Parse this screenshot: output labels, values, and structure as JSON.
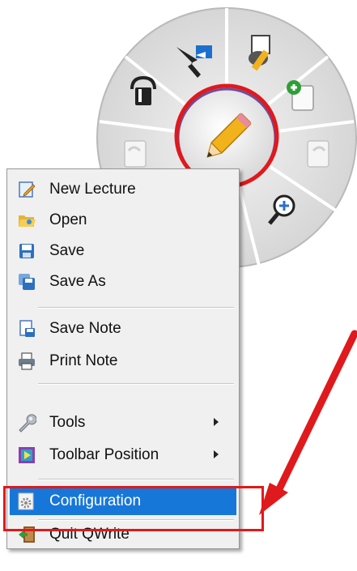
{
  "menu": {
    "items": [
      {
        "label": "New Lecture",
        "icon": "new-lecture-icon"
      },
      {
        "label": "Open",
        "icon": "open-folder-icon"
      },
      {
        "label": "Save",
        "icon": "save-disk-icon"
      },
      {
        "label": "Save As",
        "icon": "save-as-icon"
      },
      {
        "label": "Save Note",
        "icon": "save-note-icon"
      },
      {
        "label": "Print Note",
        "icon": "printer-icon"
      },
      {
        "label": "Tools",
        "icon": "wrench-icon",
        "submenu": true
      },
      {
        "label": "Toolbar Position",
        "icon": "toolbar-position-icon",
        "submenu": true
      },
      {
        "label": "Configuration",
        "icon": "gear-icon",
        "highlighted": true
      },
      {
        "label": "Quit QWrite",
        "icon": "exit-door-icon"
      }
    ]
  },
  "wheel": {
    "segments": [
      "pointer-arrow-icon",
      "eraser-pen-icon",
      "new-page-icon",
      "next-page-icon",
      "zoom-in-icon",
      "previous-page-icon",
      "paint-bucket-icon"
    ],
    "center": "pencil-icon"
  },
  "colors": {
    "annotation_red": "#e0191c",
    "highlight_blue": "#1777d9",
    "menu_bg": "#f0f0f0"
  }
}
